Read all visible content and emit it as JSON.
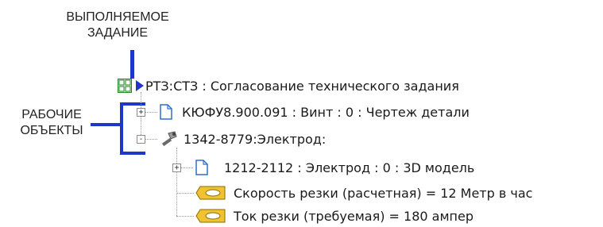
{
  "callouts": {
    "task_line1": "ВЫПОЛНЯЕМОЕ",
    "task_line2": "ЗАДАНИЕ",
    "work_line1": "РАБОЧИЕ",
    "work_line2": "ОБЪЕКТЫ"
  },
  "tree": {
    "root": {
      "label": "РТЗ:СТЗ : Согласование технического задания",
      "icon": "task-board-icon"
    },
    "items": [
      {
        "label": "КЮФУ8.900.091 : Винт : 0 : Чертеж детали",
        "icon": "document-icon",
        "expander": "+"
      },
      {
        "label": "1342-8779:Электрод:",
        "icon": "tool-icon",
        "expander": "-"
      },
      {
        "label": "1212-2112 : Электрод : 0 : 3D модель",
        "icon": "document-icon",
        "expander": "+"
      },
      {
        "label": "Скорость резки (расчетная) = 12 Метр в час",
        "icon": "tag-icon"
      },
      {
        "label": "Ток резки (требуемая) = 180 ампер",
        "icon": "tag-icon"
      }
    ]
  },
  "colors": {
    "accent": "#1f37c9",
    "board": "#2a8a2a",
    "doc": "#2f6fcf",
    "tag": "#e6a817"
  }
}
